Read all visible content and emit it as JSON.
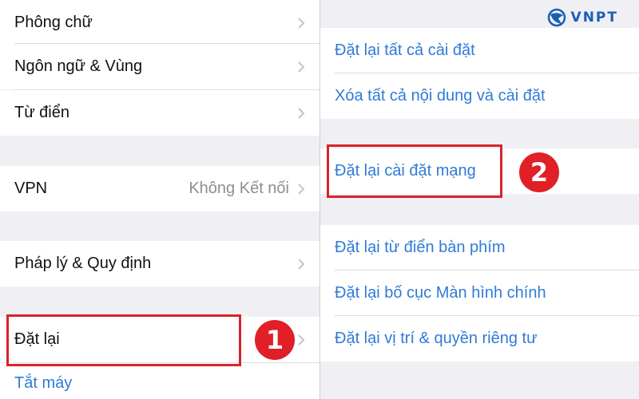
{
  "left_panel": {
    "rows": [
      {
        "label": "Phông chữ"
      },
      {
        "label": "Ngôn ngữ & Vùng"
      },
      {
        "label": "Từ điển"
      },
      {
        "label": "VPN",
        "value": "Không Kết nối"
      },
      {
        "label": "Pháp lý & Quy định"
      },
      {
        "label": "Đặt lại"
      },
      {
        "label": "Tắt máy"
      }
    ]
  },
  "right_panel": {
    "rows": [
      {
        "label": "Đặt lại tất cả cài đặt"
      },
      {
        "label": "Xóa tất cả nội dung và cài đặt"
      },
      {
        "label": "Đặt lại cài đặt mạng"
      },
      {
        "label": "Đặt lại từ điển bàn phím"
      },
      {
        "label": "Đặt lại bố cục Màn hình chính"
      },
      {
        "label": "Đặt lại vị trí & quyền riêng tư"
      }
    ]
  },
  "annotations": {
    "step1": "1",
    "step2": "2",
    "highlight_color": "#d8232a"
  },
  "logo": {
    "text": "VNPT",
    "icon": "vnpt-logo-icon"
  },
  "colors": {
    "link_blue": "#2f7bd8",
    "group_bg": "#efeff4",
    "badge_red": "#e11f26"
  }
}
